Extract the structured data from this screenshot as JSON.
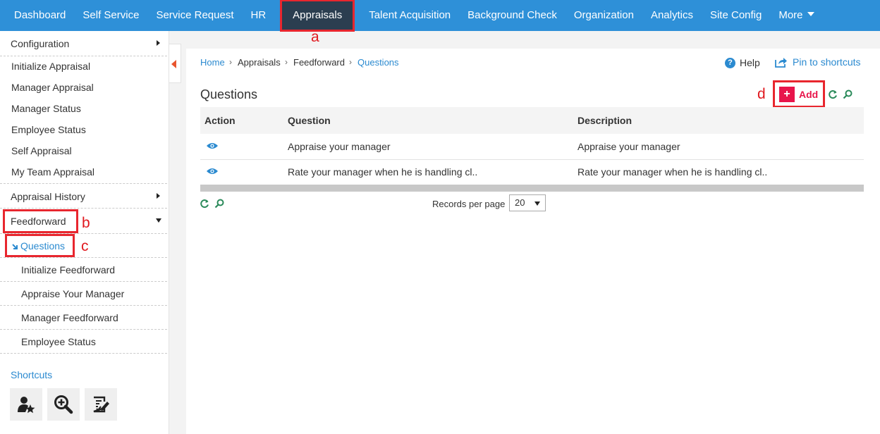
{
  "topnav": {
    "items": [
      "Dashboard",
      "Self Service",
      "Service Request",
      "HR",
      "Appraisals",
      "Talent Acquisition",
      "Background Check",
      "Organization",
      "Analytics",
      "Site Config",
      "More"
    ],
    "active": "Appraisals"
  },
  "annotations": {
    "a": "a",
    "b": "b",
    "c": "c",
    "d": "d"
  },
  "sidebar": {
    "configuration": "Configuration",
    "appraisal_items": [
      "Initialize Appraisal",
      "Manager Appraisal",
      "Manager Status",
      "Employee Status",
      "Self Appraisal",
      "My Team Appraisal"
    ],
    "appraisal_history": "Appraisal History",
    "feedforward": "Feedforward",
    "feedforward_items": [
      "Questions",
      "Initialize Feedforward",
      "Appraise Your Manager",
      "Manager Feedforward",
      "Employee Status"
    ],
    "shortcuts_title": "Shortcuts",
    "shortcut_icons": [
      "user-star-icon",
      "zoom-in-icon",
      "checklist-edit-icon"
    ]
  },
  "breadcrumb": [
    "Home",
    "Appraisals",
    "Feedforward",
    "Questions"
  ],
  "header": {
    "help": "Help",
    "pin": "Pin to shortcuts"
  },
  "page_title": "Questions",
  "toolbar": {
    "add_label": "Add",
    "add_symbol": "+"
  },
  "table": {
    "columns": [
      "Action",
      "Question",
      "Description"
    ],
    "rows": [
      {
        "question": "Appraise your manager",
        "description": "Appraise your manager"
      },
      {
        "question": "Rate your manager when he is handling cl..",
        "description": "Rate your manager when he is handling cl.."
      }
    ]
  },
  "pager": {
    "records_label": "Records per page",
    "records_value": "20"
  },
  "colors": {
    "nav_blue": "#2e90d8",
    "active_dark": "#2b3e50",
    "accent_pink": "#e8154b",
    "annotation_red": "#e8262e",
    "link_blue": "#2b8ad0"
  }
}
